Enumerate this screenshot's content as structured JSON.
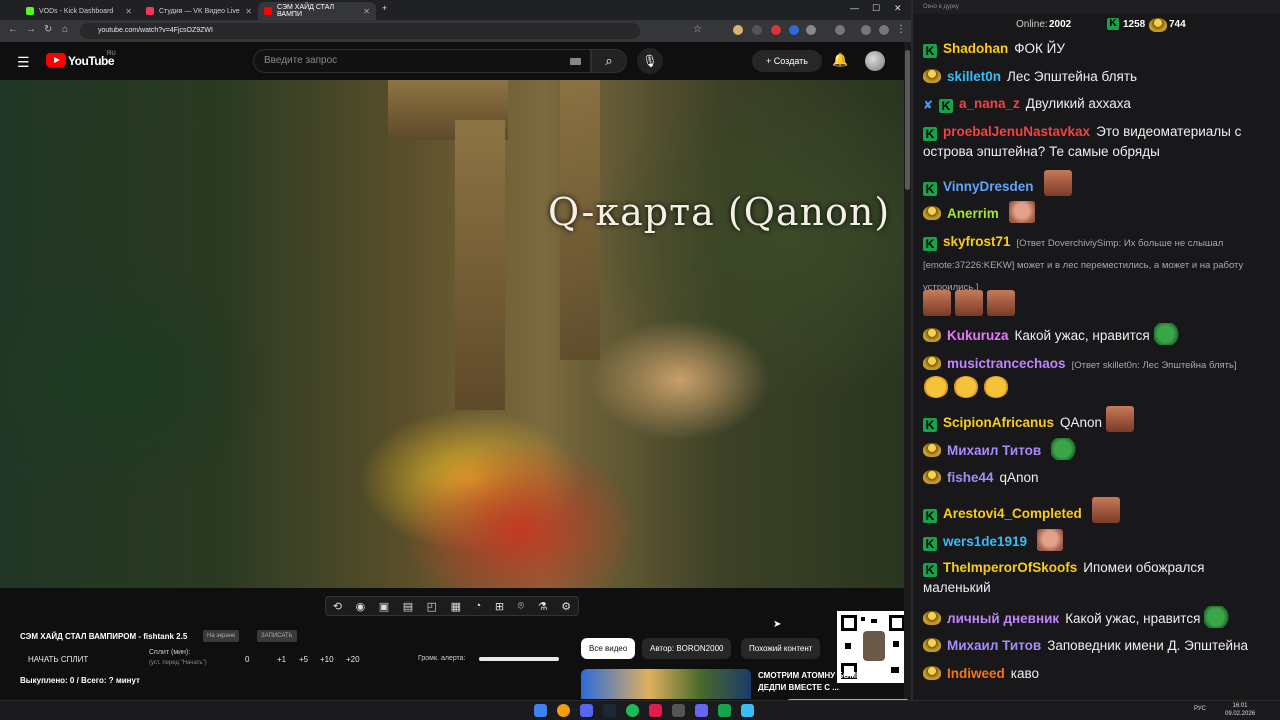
{
  "browser": {
    "tabs": [
      {
        "label": "VODs - Kick Dashboard",
        "color": "#53fc18"
      },
      {
        "label": "Студия — VK Видео Live",
        "color": "#ff3355"
      },
      {
        "label": "СЭМ ХАЙД СТАЛ ВАМПИ",
        "color": "#ff0000"
      }
    ],
    "new_tab": "+",
    "url": "youtube.com/watch?v=4FjcsOZ9ZWI"
  },
  "youtube": {
    "logo_text": "YouTube",
    "region": "RU",
    "search_placeholder": "Введите запрос",
    "create_label": "Создать",
    "video_overlay_text": "Q-карта (Qanon)",
    "title": "СЭМ ХАЙД СТАЛ ВАМПИРОМ - fishtank 2.5",
    "pill1": "На экране",
    "pill2": "ЗАПИСАТЬ",
    "split_button": "НАЧАТЬ СПЛИТ",
    "split_label": "Сплит (мин):",
    "split_sub": "(уст. перед \"Начать\")",
    "split_values": [
      "0",
      "+1",
      "+5",
      "+10",
      "+20"
    ],
    "volume_label": "Громк. алерта:",
    "volume_level": 1.0,
    "payout": "Выкуплено: 0 / Всего: ? минут",
    "chips": [
      "Все видео",
      "Автор: BORON2000",
      "Похожий контент"
    ],
    "rec_title": "СМОТРИМ АТОМНУ БОМБУ ДЕДПИ ВМЕСТЕ С ..."
  },
  "chat": {
    "online_label": "Online:",
    "online_count": "2002",
    "count_a": "1258",
    "count_b": "744",
    "messages": [
      {
        "badge": "k",
        "user": "Shadohan",
        "color": "#facc15",
        "text": "ФОК ЙУ"
      },
      {
        "badge": "p",
        "user": "skillet0n",
        "color": "#38bdf8",
        "text": "Лес Эпштейна блять"
      },
      {
        "badge": "xk",
        "user": "a_nana_z",
        "color": "#ef4444",
        "text": "Двуликий аххаха"
      },
      {
        "badge": "k",
        "user": "proebalJenuNastavkax",
        "color": "#ef4444",
        "text": "Это видеоматериалы с острова эпштейна? Те самые обряды"
      },
      {
        "badge": "k",
        "user": "VinnyDresden",
        "color": "#60a5fa",
        "text": ""
      },
      {
        "badge": "p",
        "user": "Anerrim",
        "color": "#a3e635",
        "text": ""
      },
      {
        "badge": "k",
        "user": "skyfrost71",
        "color": "#facc15",
        "reply": "[Ответ DoverchiviySimp: Их больше не слышал [emote:37226:KEKW] может и в лес переместились, а может и на работу устроились.]",
        "text": ""
      },
      {
        "badge": "p",
        "user": "Kukuruza",
        "color": "#e879f9",
        "text": "Какой ужас, нравится"
      },
      {
        "badge": "p",
        "user": "musictrancechaos",
        "color": "#c084fc",
        "reply": "[Ответ skillet0n: Лес Эпштейна блять]",
        "text": ""
      },
      {
        "badge": "k",
        "user": "ScipionAfricanus",
        "color": "#facc15",
        "text": "QAnon"
      },
      {
        "badge": "p",
        "user": "Михаил Титов",
        "color": "#a78bfa",
        "text": ""
      },
      {
        "badge": "p",
        "user": "fishe44",
        "color": "#a78bfa",
        "text": "qAnon"
      },
      {
        "badge": "k",
        "user": "Arestovi4_Completed",
        "color": "#facc15",
        "text": ""
      },
      {
        "badge": "k",
        "user": "wers1de1919",
        "color": "#38bdf8",
        "text": ""
      },
      {
        "badge": "k",
        "user": "TheImperorOfSkoofs",
        "color": "#facc15",
        "text": "Ипомеи обожрался маленький"
      },
      {
        "badge": "p",
        "user": "личный дневник",
        "color": "#c084fc",
        "text": "Какой ужас, нравится"
      },
      {
        "badge": "p",
        "user": "Михаил Титов",
        "color": "#a78bfa",
        "text": "Заповедник имени Д. Эпштейна"
      },
      {
        "badge": "p",
        "user": "Indiweed",
        "color": "#f97316",
        "text": "каво"
      }
    ],
    "window_title": "Окно в дурку"
  },
  "taskbar": {
    "lang": "РУС",
    "time": "16:01",
    "date": "09.02.2026"
  }
}
